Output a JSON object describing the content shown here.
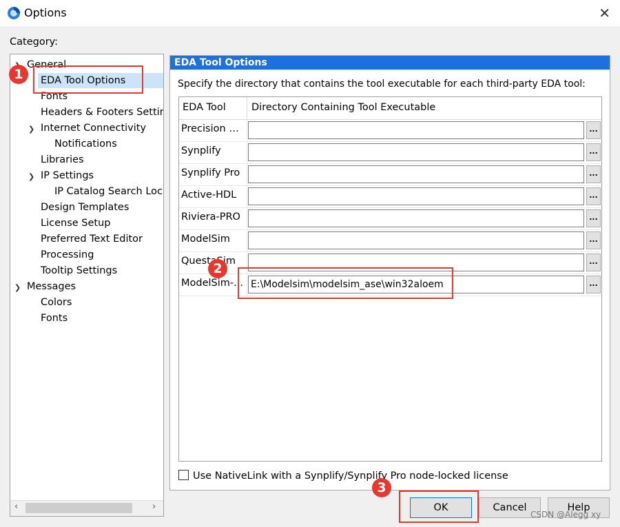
{
  "window": {
    "title": "Options"
  },
  "category_label": "Category:",
  "tree": {
    "items": [
      {
        "label": "General",
        "expanded": true
      },
      {
        "label": "EDA Tool Options",
        "selected": true
      },
      {
        "label": "Fonts"
      },
      {
        "label": "Headers & Footers Setting"
      },
      {
        "label": "Internet Connectivity",
        "expanded": true
      },
      {
        "label": "Notifications"
      },
      {
        "label": "Libraries"
      },
      {
        "label": "IP Settings",
        "expanded": true
      },
      {
        "label": "IP Catalog Search Locat"
      },
      {
        "label": "Design Templates"
      },
      {
        "label": "License Setup"
      },
      {
        "label": "Preferred Text Editor"
      },
      {
        "label": "Processing"
      },
      {
        "label": "Tooltip Settings"
      },
      {
        "label": "Messages",
        "expanded": true
      },
      {
        "label": "Colors"
      },
      {
        "label": "Fonts"
      }
    ]
  },
  "panel": {
    "header": "EDA Tool Options",
    "description": "Specify the directory that contains the tool executable for each third-party EDA tool:",
    "columns": [
      "EDA Tool",
      "Directory Containing Tool Executable"
    ],
    "rows": [
      {
        "tool": "Precision S...",
        "path": ""
      },
      {
        "tool": "Synplify",
        "path": ""
      },
      {
        "tool": "Synplify Pro",
        "path": ""
      },
      {
        "tool": "Active-HDL",
        "path": ""
      },
      {
        "tool": "Riviera-PRO",
        "path": ""
      },
      {
        "tool": "ModelSim",
        "path": ""
      },
      {
        "tool": "QuestaSim",
        "path": ""
      },
      {
        "tool": "ModelSim-...",
        "path": "E:\\Modelsim\\modelsim_ase\\win32aloem"
      }
    ],
    "browse_label": "...",
    "checkbox_label": "Use NativeLink with a Synplify/Synplify Pro node-locked license"
  },
  "buttons": {
    "ok": "OK",
    "cancel": "Cancel",
    "help": "Help"
  },
  "annotations": [
    "1",
    "2",
    "3"
  ],
  "watermark": "CSDN @Alegg xy",
  "colors": {
    "header_blue": "#1e6fe0",
    "selection": "#cce4f7",
    "annotation_red": "#e8372c"
  }
}
